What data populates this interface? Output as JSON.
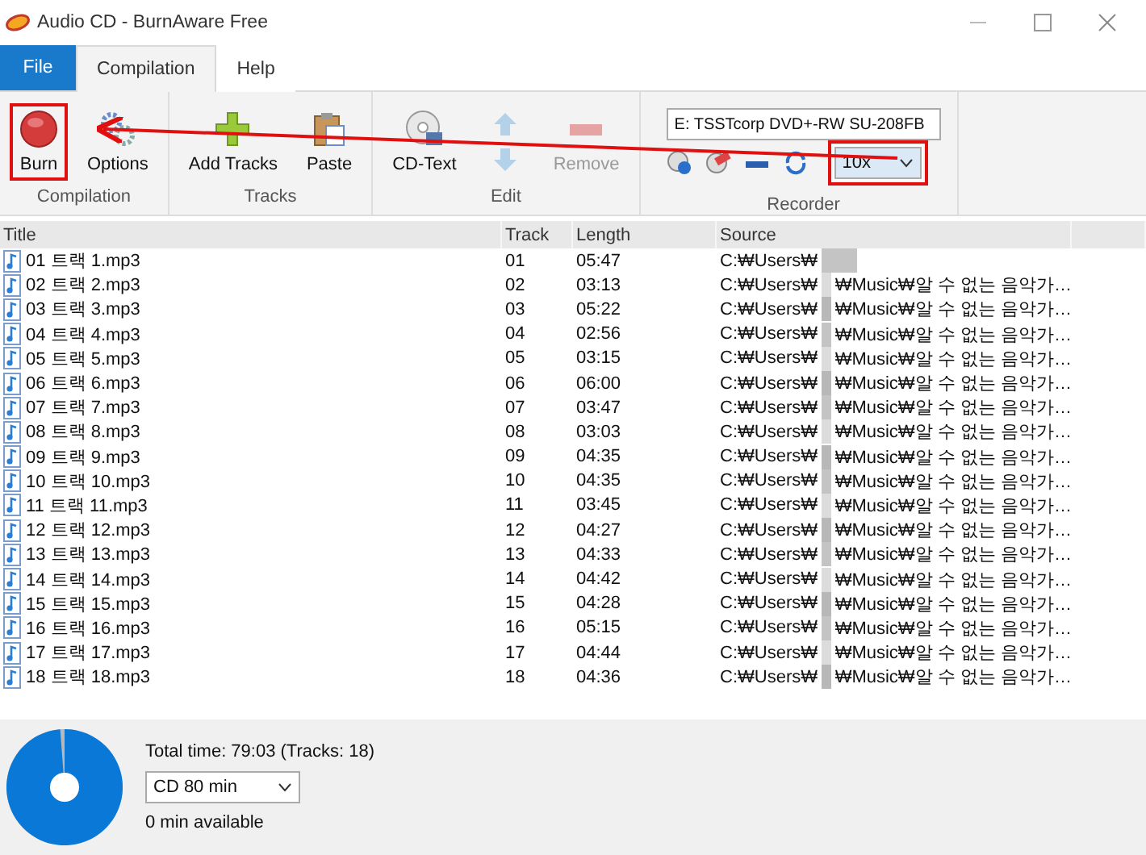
{
  "window": {
    "title": "Audio CD - BurnAware Free"
  },
  "tabs": [
    {
      "label": "File",
      "kind": "menu",
      "selected": false
    },
    {
      "label": "Compilation",
      "kind": "tab",
      "selected": true
    },
    {
      "label": "Help",
      "kind": "tab",
      "selected": false
    }
  ],
  "ribbon": {
    "groups": [
      {
        "label": "Compilation",
        "buttons": [
          {
            "label": "Burn",
            "kind": "burn",
            "disabled": false,
            "highlighted": true
          },
          {
            "label": "Options",
            "kind": "options",
            "disabled": false
          }
        ]
      },
      {
        "label": "Tracks",
        "buttons": [
          {
            "label": "Add Tracks",
            "kind": "add",
            "disabled": false
          },
          {
            "label": "Paste",
            "kind": "paste",
            "disabled": false
          }
        ]
      },
      {
        "label": "Edit",
        "buttons": [
          {
            "label": "CD-Text",
            "kind": "cdtext",
            "disabled": false
          },
          {
            "kind": "updown",
            "disabled": true
          },
          {
            "label": "Remove",
            "kind": "remove",
            "disabled": true
          }
        ]
      }
    ],
    "recorder": {
      "label": "Recorder",
      "drive": "E: TSSTcorp DVD+-RW SU-208FB",
      "speed": "10x",
      "speed_highlighted": true
    }
  },
  "table": {
    "columns": [
      "Title",
      "Track",
      "Length",
      "Source"
    ],
    "rows": [
      {
        "title": "01 트랙 1.mp3",
        "track": "01",
        "length": "05:47",
        "source_start": "C:₩Users₩"
      },
      {
        "title": "02 트랙 2.mp3",
        "track": "02",
        "length": "03:13",
        "source_start": "C:₩Users₩",
        "source_end": "₩Music₩알 수 없는 음악가…"
      },
      {
        "title": "03 트랙 3.mp3",
        "track": "03",
        "length": "05:22",
        "source_start": "C:₩Users₩",
        "source_end": "₩Music₩알 수 없는 음악가…"
      },
      {
        "title": "04 트랙 4.mp3",
        "track": "04",
        "length": "02:56",
        "source_start": "C:₩Users₩",
        "source_end": "₩Music₩알 수 없는 음악가…"
      },
      {
        "title": "05 트랙 5.mp3",
        "track": "05",
        "length": "03:15",
        "source_start": "C:₩Users₩",
        "source_end": "₩Music₩알 수 없는 음악가…"
      },
      {
        "title": "06 트랙 6.mp3",
        "track": "06",
        "length": "06:00",
        "source_start": "C:₩Users₩",
        "source_end": "₩Music₩알 수 없는 음악가…"
      },
      {
        "title": "07 트랙 7.mp3",
        "track": "07",
        "length": "03:47",
        "source_start": "C:₩Users₩",
        "source_end": "₩Music₩알 수 없는 음악가…"
      },
      {
        "title": "08 트랙 8.mp3",
        "track": "08",
        "length": "03:03",
        "source_start": "C:₩Users₩",
        "source_end": "₩Music₩알 수 없는 음악가…"
      },
      {
        "title": "09 트랙 9.mp3",
        "track": "09",
        "length": "04:35",
        "source_start": "C:₩Users₩",
        "source_end": "₩Music₩알 수 없는 음악가…"
      },
      {
        "title": "10 트랙 10.mp3",
        "track": "10",
        "length": "04:35",
        "source_start": "C:₩Users₩",
        "source_end": "₩Music₩알 수 없는 음악가…"
      },
      {
        "title": "11 트랙 11.mp3",
        "track": "11",
        "length": "03:45",
        "source_start": "C:₩Users₩",
        "source_end": "₩Music₩알 수 없는 음악가…"
      },
      {
        "title": "12 트랙 12.mp3",
        "track": "12",
        "length": "04:27",
        "source_start": "C:₩Users₩",
        "source_end": "₩Music₩알 수 없는 음악가…"
      },
      {
        "title": "13 트랙 13.mp3",
        "track": "13",
        "length": "04:33",
        "source_start": "C:₩Users₩",
        "source_end": "₩Music₩알 수 없는 음악가…"
      },
      {
        "title": "14 트랙 14.mp3",
        "track": "14",
        "length": "04:42",
        "source_start": "C:₩Users₩",
        "source_end": "₩Music₩알 수 없는 음악가…"
      },
      {
        "title": "15 트랙 15.mp3",
        "track": "15",
        "length": "04:28",
        "source_start": "C:₩Users₩",
        "source_end": "₩Music₩알 수 없는 음악가…"
      },
      {
        "title": "16 트랙 16.mp3",
        "track": "16",
        "length": "05:15",
        "source_start": "C:₩Users₩",
        "source_end": "₩Music₩알 수 없는 음악가…"
      },
      {
        "title": "17 트랙 17.mp3",
        "track": "17",
        "length": "04:44",
        "source_start": "C:₩Users₩",
        "source_end": "₩Music₩알 수 없는 음악가…"
      },
      {
        "title": "18 트랙 18.mp3",
        "track": "18",
        "length": "04:36",
        "source_start": "C:₩Users₩",
        "source_end": "₩Music₩알 수 없는 음악가…"
      }
    ]
  },
  "status": {
    "total": "Total time: 79:03 (Tracks: 18)",
    "disc_type": "CD 80 min",
    "available": "0 min available",
    "level": 0.988
  }
}
